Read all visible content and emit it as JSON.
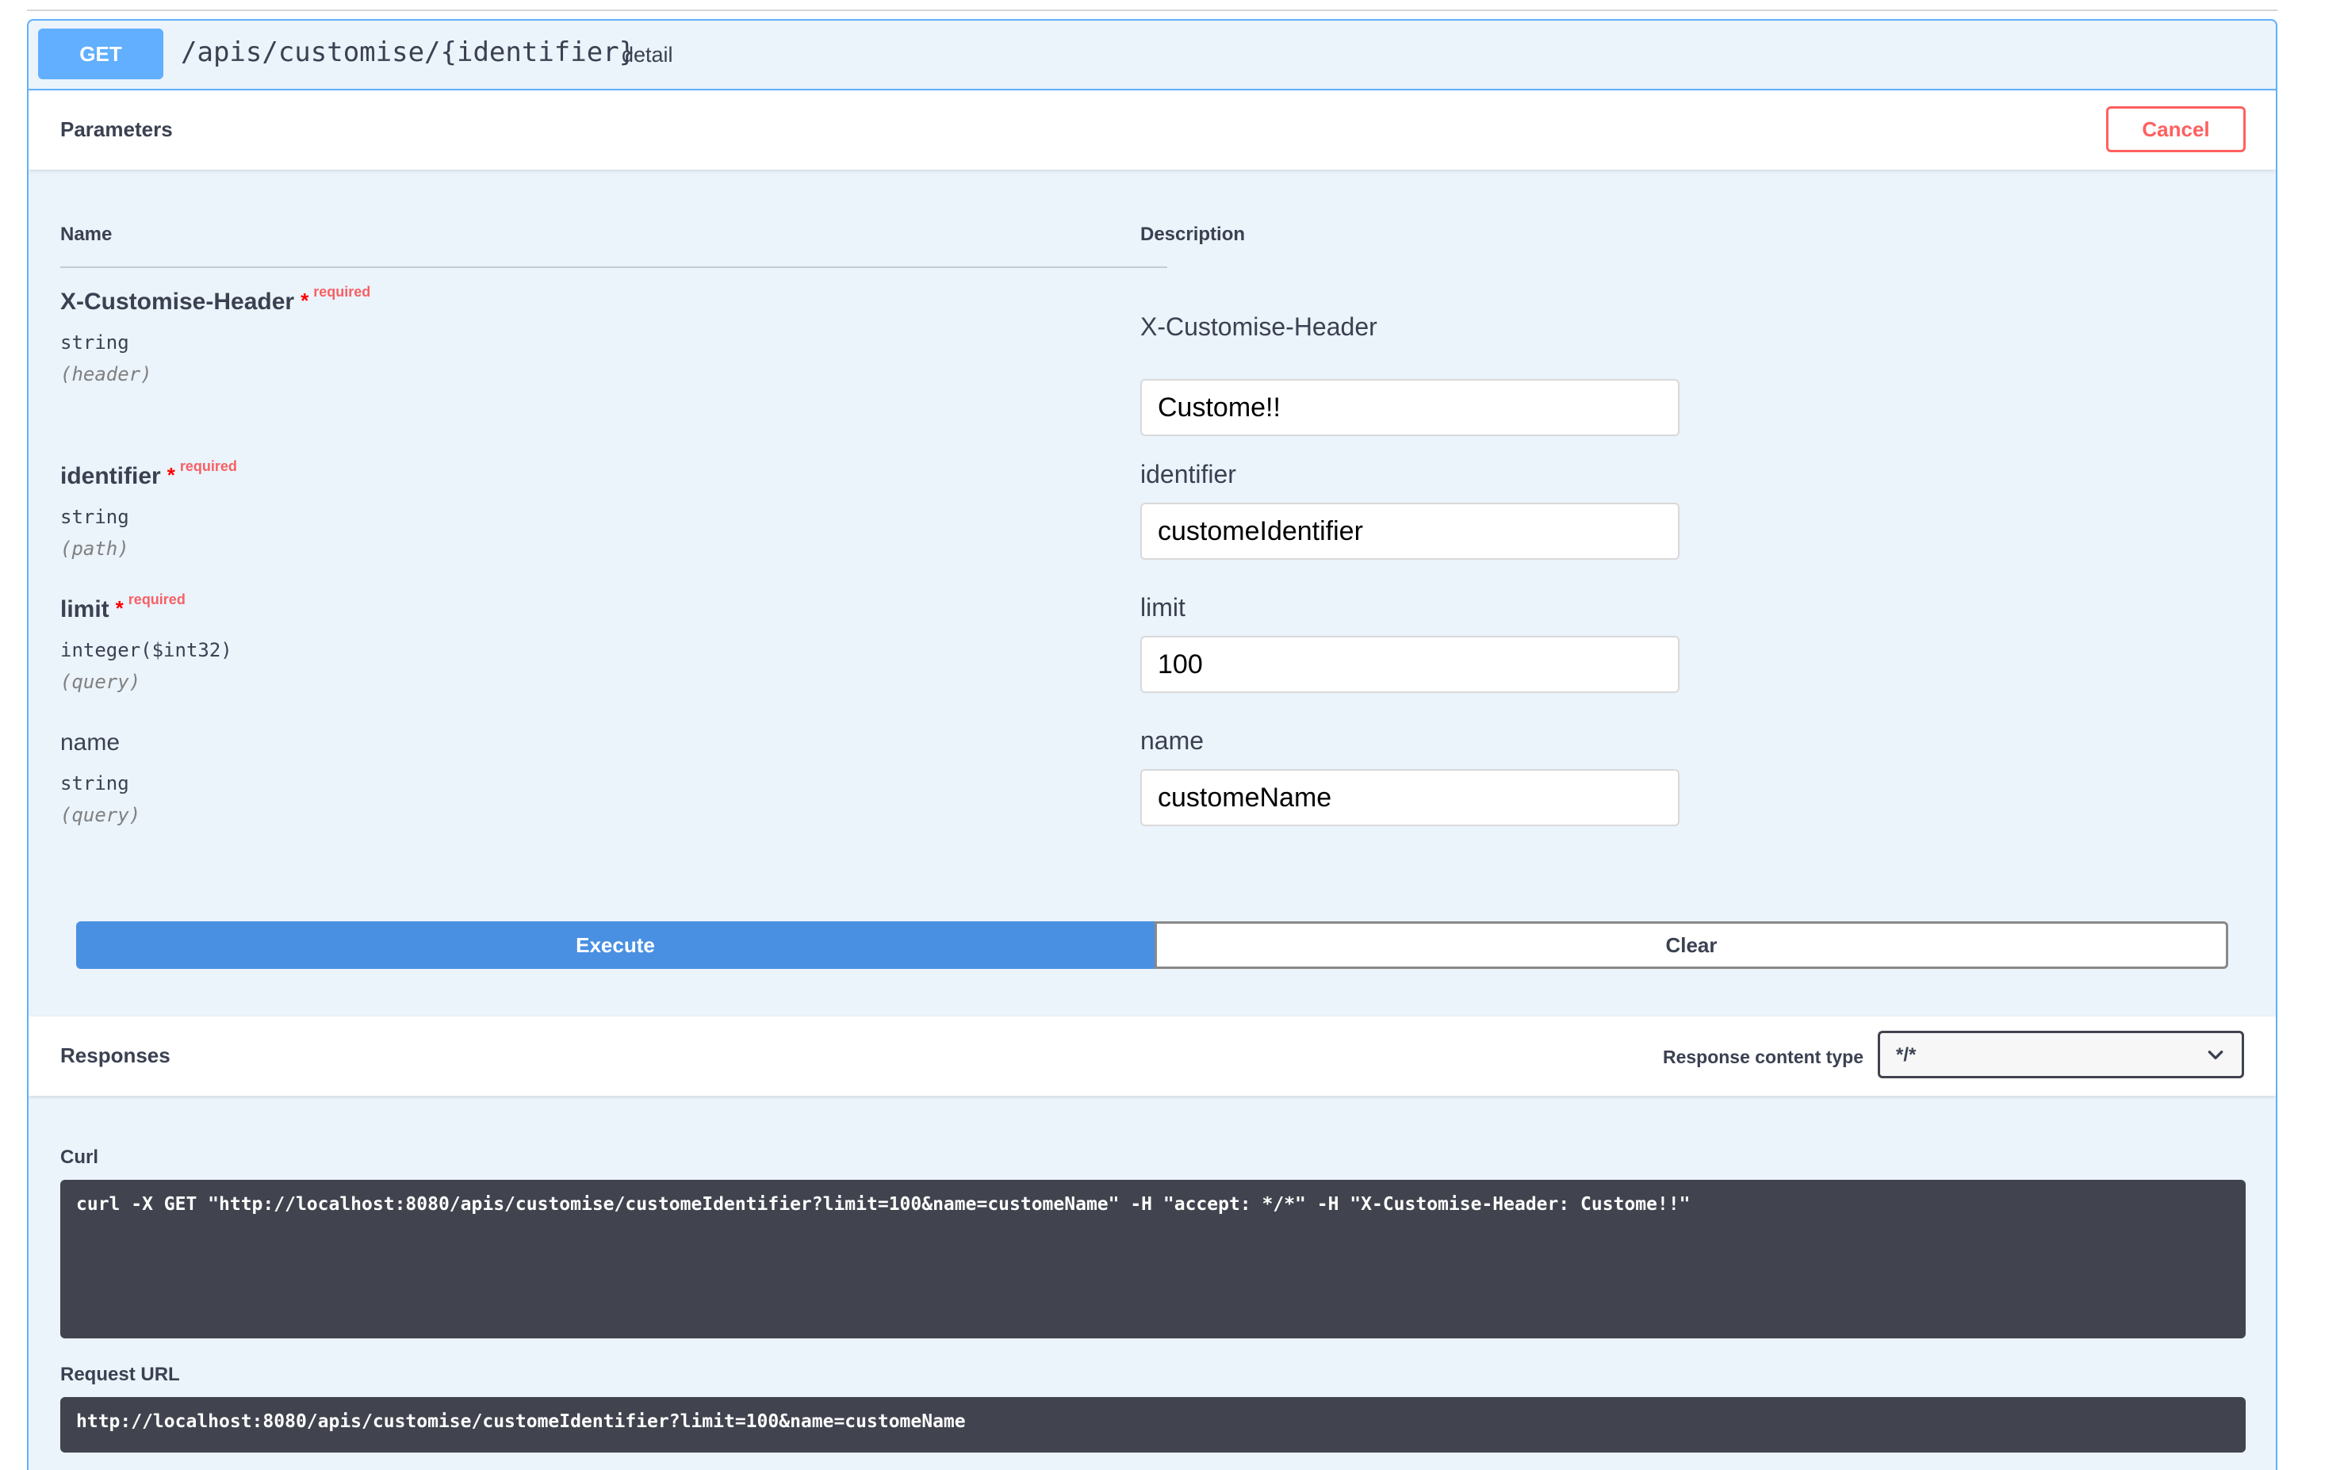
{
  "operation": {
    "method": "GET",
    "path": "/apis/customise/{identifier}",
    "summary": "detail"
  },
  "parameters_section": {
    "title": "Parameters",
    "cancel_label": "Cancel",
    "col_name": "Name",
    "col_description": "Description"
  },
  "parameters": [
    {
      "name": "X-Customise-Header",
      "star": "*",
      "required_label": "required",
      "type": "string",
      "in": "(header)",
      "description": "X-Customise-Header",
      "value": "Custome!!"
    },
    {
      "name": "identifier",
      "star": "*",
      "required_label": "required",
      "type": "string",
      "in": "(path)",
      "description": "identifier",
      "value": "customeIdentifier"
    },
    {
      "name": "limit",
      "star": "*",
      "required_label": "required",
      "type": "integer($int32)",
      "in": "(query)",
      "description": "limit",
      "value": "100"
    },
    {
      "name": "name",
      "type": "string",
      "in": "(query)",
      "description": "name",
      "value": "customeName"
    }
  ],
  "actions": {
    "execute_label": "Execute",
    "clear_label": "Clear"
  },
  "responses_section": {
    "title": "Responses",
    "content_type_label": "Response content type",
    "content_type_value": "*/*",
    "curl_label": "Curl",
    "curl_command": "curl -X GET \"http://localhost:8080/apis/customise/customeIdentifier?limit=100&name=customeName\" -H \"accept: */*\" -H \"X-Customise-Header: Custome!!\"",
    "request_url_label": "Request URL",
    "request_url": "http://localhost:8080/apis/customise/customeIdentifier?limit=100&name=customeName"
  },
  "colors": {
    "get_method": "#61affe",
    "execute": "#4990e2",
    "cancel": "#ff6060",
    "code_background": "#41444e"
  },
  "icons": {
    "select_chevron": "chevron-down-icon"
  }
}
